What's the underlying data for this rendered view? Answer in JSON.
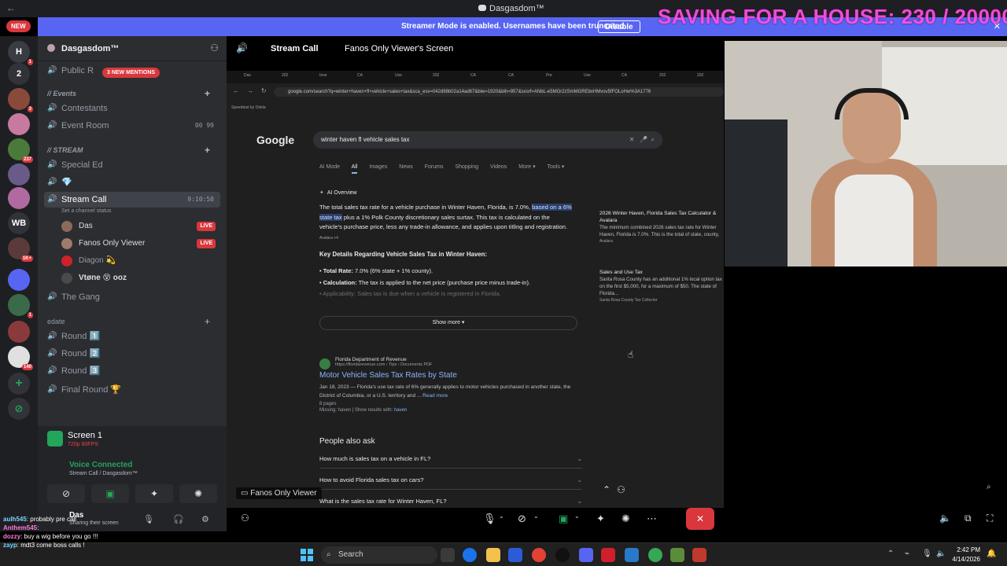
{
  "window": {
    "title": "Dasgasdom™",
    "back": "←"
  },
  "overlay": {
    "goal_text": "SAVING FOR A HOUSE: 230 / 20000"
  },
  "banner": {
    "message": "Streamer Mode is enabled. Usernames have been truncated.",
    "disable_label": "Disable",
    "close": "✕"
  },
  "new_badge": "NEW",
  "rail": {
    "servers": [
      {
        "label": "H",
        "badge": "1"
      },
      {
        "label": "2",
        "badge": ""
      },
      {
        "label": "",
        "badge": "3"
      },
      {
        "label": "",
        "badge": ""
      },
      {
        "label": "",
        "badge": "237"
      },
      {
        "label": "",
        "badge": ""
      },
      {
        "label": "",
        "badge": ""
      },
      {
        "label": "WB",
        "badge": ""
      },
      {
        "label": "",
        "badge": "1K+"
      },
      {
        "label": "",
        "badge": ""
      },
      {
        "label": "",
        "badge": "1"
      },
      {
        "label": "",
        "badge": "140"
      }
    ]
  },
  "sidebar": {
    "server_name": "Dasgasdom™",
    "mentions": "3 NEW MENTIONS",
    "public_channel": "Public R",
    "cat_events": "// Events",
    "contestants": "Contestants",
    "event_room": "Event Room",
    "event_room_counts": "00   99",
    "cat_stream": "// STREAM",
    "special_ed": "Special Ed",
    "stream_call": "Stream Call",
    "stream_timer": "9:10:58",
    "set_status": "Set a channel status",
    "users": [
      {
        "name": "Das",
        "live": "LIVE"
      },
      {
        "name": "Fanos Only Viewer",
        "live": "LIVE"
      },
      {
        "name": "Diagon 💫",
        "live": ""
      },
      {
        "name": "Vtøne 😵 ooz",
        "live": ""
      }
    ],
    "the_gang": "The Gang",
    "cat_edate": "edate",
    "rounds": [
      "Round 1️⃣",
      "Round 2️⃣",
      "Round 3️⃣",
      "Final Round 🏆"
    ]
  },
  "panel": {
    "screen_title": "Screen 1",
    "screen_sub": "720p 60FPS",
    "voice_connected": "Voice Connected",
    "voice_channel": "Stream Call / Dasgasdom™",
    "user_name": "Das",
    "user_status": "Sharing their screen"
  },
  "chat": [
    {
      "user": "aulh545",
      "msg": ": probably pre call"
    },
    {
      "user": "Anthem545",
      "msg": ":"
    },
    {
      "user": "dozzy",
      "msg": ": buy a wig before you go !!!"
    },
    {
      "user": "zayp",
      "msg": ": mdt3 come boss calls !"
    }
  ],
  "stage": {
    "channel": "Stream Call",
    "viewing": "Fanos Only Viewer's Screen",
    "bottom_label": "Fanos Only Viewer"
  },
  "browser": {
    "url": "google.com/search?q=winter+haven+fl+vehicle+sales+tax&sca_esv=042d98b02a14ad67&biw=1920&bih=957&sxsrf=ANbL-e5MGr2zSmMGREbxHMvov5fFOLoHw%3A1776",
    "bookmark": "Speedtest by Ookla",
    "tabs": [
      "Das",
      "202",
      "Inve",
      "CA",
      "Use",
      "202",
      "CA",
      "CA",
      "Pre",
      "Use",
      "CA",
      "202",
      "202"
    ]
  },
  "google": {
    "logo": "Google",
    "query": "winter haven fl vehicle sales tax",
    "tabs": [
      "AI Mode",
      "All",
      "Images",
      "News",
      "Forums",
      "Shopping",
      "Videos",
      "More ▾",
      "Tools ▾"
    ],
    "ai_header": "AI Overview",
    "ai_p1": "The total sales tax rate for a vehicle purchase in Winter Haven, Florida, is 7.0%,",
    "ai_hl": "based on a 6% state tax",
    "ai_p2": "plus a 1% Polk County discretionary sales surtax. This tax is calculated on the vehicle's purchase price, less any trade-in allowance, and applies upon titling and registration.",
    "ai_src": "Avalara +4",
    "key_details": "Key Details Regarding Vehicle Sales Tax in Winter Haven:",
    "bullet1_b": "Total Rate:",
    "bullet1": "7.0% (6% state + 1% county).",
    "bullet2_b": "Calculation:",
    "bullet2": "The tax is applied to the net price (purchase price minus trade-in).",
    "bullet3": "Applicability: Sales tax is due when a vehicle is registered in Florida.",
    "show_more": "Show more ▾",
    "side1_title": "2026 Winter Haven, Florida Sales Tax Calculator & Avalara",
    "side1_body": "The minimum combined 2026 sales tax rate for Winter Haven, Florida is 7.0%. This is the total of state, county,",
    "side1_src": "Avalara",
    "side2_title": "Sales and Use Tax",
    "side2_body": "Santa Rosa County has an additional 1% local option tax on the first $5,000, for a maximum of $50. The state of Florida...",
    "side2_src": "Santa Rosa County Tax Collector",
    "result_site": "Florida Department of Revenue",
    "result_url": "https://floridarevenue.com › Tips › Documents",
    "result_badge": "PDF",
    "result_title": "Motor Vehicle Sales Tax Rates by State",
    "result_snip": "Jan 18, 2023 — Florida's use tax rate of 6% generally applies to motor vehicles purchased in another state, the District of Columbia, or a U.S. territory and ...",
    "read_more": "Read more",
    "result_pages": "8 pages",
    "result_missing": "Missing: haven | Show results with:",
    "result_missing_h": "haven",
    "paa_title": "People also ask",
    "paa": [
      "How much is sales tax on a vehicle in FL?",
      "How to avoid Florida sales tax on cars?",
      "What is the sales tax rate for Winter Haven, FL?"
    ]
  },
  "taskbar": {
    "search": "Search",
    "time": "2:42 PM",
    "date": "4/14/2026"
  },
  "colors": {
    "accent": "#5865f2",
    "live": "#da373c",
    "connected": "#23a55a",
    "overlay": "#ff4fe8"
  }
}
